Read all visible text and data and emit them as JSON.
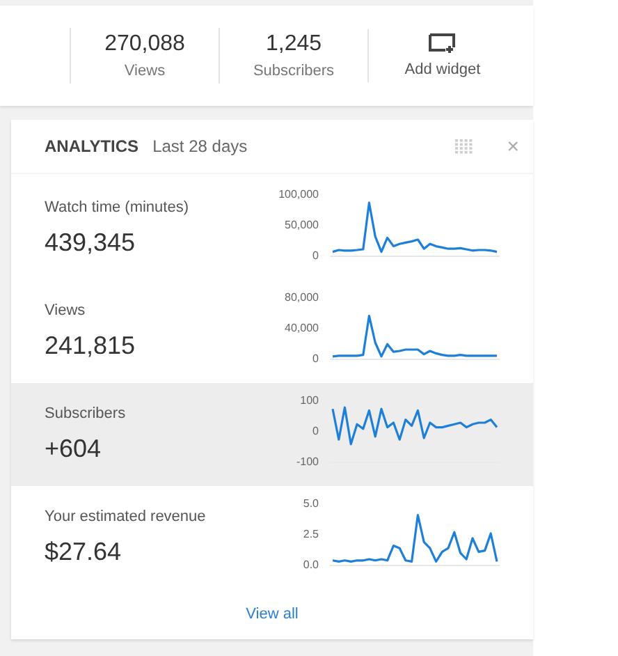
{
  "stats": [
    {
      "value": "270,088",
      "label": "Views"
    },
    {
      "value": "1,245",
      "label": "Subscribers"
    }
  ],
  "add_widget": {
    "label": "Add widget"
  },
  "analytics": {
    "title": "ANALYTICS",
    "period": "Last 28 days",
    "close": "×",
    "metrics": [
      {
        "label": "Watch time (minutes)",
        "value": "439,345",
        "highlighted": false,
        "chart_data": {
          "type": "line",
          "ylim": [
            0,
            100000
          ],
          "yticks": [
            {
              "value": 0,
              "label": "0"
            },
            {
              "value": 50000,
              "label": "50,000"
            },
            {
              "value": 100000,
              "label": "100,000"
            }
          ],
          "series": [
            {
              "color": "#1e7fd8",
              "values": [
                5000,
                8000,
                7000,
                7000,
                8000,
                9000,
                85000,
                30000,
                5000,
                28000,
                14000,
                18000,
                20000,
                22000,
                25000,
                10000,
                18000,
                14000,
                12000,
                10000,
                10000,
                11000,
                9000,
                7000,
                8000,
                8000,
                7000,
                5000
              ]
            }
          ]
        }
      },
      {
        "label": "Views",
        "value": "241,815",
        "highlighted": false,
        "chart_data": {
          "type": "line",
          "ylim": [
            0,
            80000
          ],
          "yticks": [
            {
              "value": 0,
              "label": "0"
            },
            {
              "value": 40000,
              "label": "40,000"
            },
            {
              "value": 80000,
              "label": "80,000"
            }
          ],
          "series": [
            {
              "color": "#1e7fd8",
              "values": [
                2000,
                3000,
                3000,
                3000,
                3000,
                4000,
                55000,
                20000,
                2000,
                18000,
                8000,
                9000,
                11000,
                11000,
                11000,
                5000,
                9000,
                6000,
                4000,
                3000,
                3000,
                4000,
                3000,
                3000,
                3000,
                3000,
                3000,
                3000
              ]
            }
          ]
        }
      },
      {
        "label": "Subscribers",
        "value": "+604",
        "highlighted": true,
        "chart_data": {
          "type": "line",
          "ylim": [
            -100,
            100
          ],
          "yticks": [
            {
              "value": -100,
              "label": "-100"
            },
            {
              "value": 0,
              "label": "0"
            },
            {
              "value": 100,
              "label": "100"
            }
          ],
          "series": [
            {
              "color": "#1e7fd8",
              "values": [
                70,
                -30,
                75,
                -45,
                20,
                5,
                65,
                -20,
                70,
                10,
                25,
                -30,
                35,
                15,
                65,
                -25,
                25,
                10,
                10,
                15,
                20,
                25,
                10,
                20,
                25,
                25,
                35,
                10
              ]
            }
          ]
        }
      },
      {
        "label": "Your estimated revenue",
        "value": "$27.64",
        "highlighted": false,
        "chart_data": {
          "type": "line",
          "ylim": [
            0,
            5
          ],
          "yticks": [
            {
              "value": 0,
              "label": "0.0"
            },
            {
              "value": 2.5,
              "label": "2.5"
            },
            {
              "value": 5,
              "label": "5.0"
            }
          ],
          "series": [
            {
              "color": "#1e7fd8",
              "values": [
                0.3,
                0.2,
                0.3,
                0.2,
                0.3,
                0.3,
                0.4,
                0.3,
                0.4,
                0.3,
                1.5,
                1.3,
                0.3,
                0.2,
                4.0,
                1.8,
                1.3,
                0.2,
                1.0,
                1.3,
                2.6,
                0.9,
                0.4,
                2.1,
                1.0,
                1.1,
                2.5,
                0.2
              ]
            }
          ]
        }
      }
    ],
    "view_all": "View all"
  }
}
